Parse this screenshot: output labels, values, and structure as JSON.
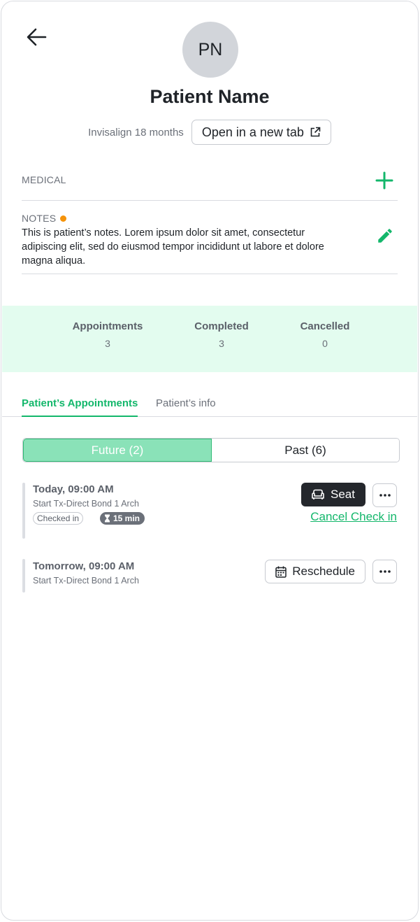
{
  "header": {
    "back_icon": "arrow-left-icon",
    "avatar_initials": "PN",
    "patient_name": "Patient Name",
    "treatment_plan": "Invisalign 18 months",
    "open_new_tab_label": "Open in a new tab",
    "open_new_tab_icon": "external-link-icon"
  },
  "medical": {
    "label": "MEDICAL",
    "add_icon": "plus-icon"
  },
  "notes": {
    "label": "NOTES",
    "text": "This is patient’s notes. Lorem ipsum dolor sit amet, consectetur adipiscing elit, sed do eiusmod tempor incididunt ut labore et dolore magna aliqua.",
    "edit_icon": "pencil-icon",
    "indicator_color": "#f5930a"
  },
  "stats": [
    {
      "label": "Appointments",
      "value": "3"
    },
    {
      "label": "Completed",
      "value": "3"
    },
    {
      "label": "Cancelled",
      "value": "0"
    }
  ],
  "tabs": [
    {
      "label": "Patient’s Appointments",
      "active": true
    },
    {
      "label": "Patient’s info",
      "active": false
    }
  ],
  "segments": {
    "future_label": "Future (2)",
    "past_label": "Past (6)"
  },
  "appointments": [
    {
      "time": "Today, 09:00 AM",
      "description": "Start Tx-Direct Bond 1 Arch",
      "status_badge": "Checked in",
      "timer_badge": "15 min",
      "timer_icon": "hourglass-icon",
      "primary_action": "Seat",
      "primary_icon": "armchair-icon",
      "secondary_link": "Cancel Check in",
      "more_icon": "ellipsis-icon"
    },
    {
      "time": "Tomorrow, 09:00 AM",
      "description": "Start Tx-Direct Bond 1 Arch",
      "primary_action": "Reschedule",
      "primary_icon": "calendar-icon",
      "more_icon": "ellipsis-icon"
    }
  ],
  "colors": {
    "accent": "#13b76b",
    "stats_background": "#e3fcef",
    "segment_active": "#8ae2b8",
    "seat_button": "#24272c"
  }
}
